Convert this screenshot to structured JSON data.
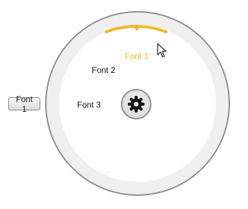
{
  "side_button": {
    "label": "Font 1"
  },
  "radial_menu": {
    "items": [
      {
        "label": "Font 1",
        "selected": true
      },
      {
        "label": "Font 2",
        "selected": false
      },
      {
        "label": "Font 3",
        "selected": false
      }
    ],
    "center_icon": "gear-icon",
    "accent_color": "#f2b824"
  }
}
